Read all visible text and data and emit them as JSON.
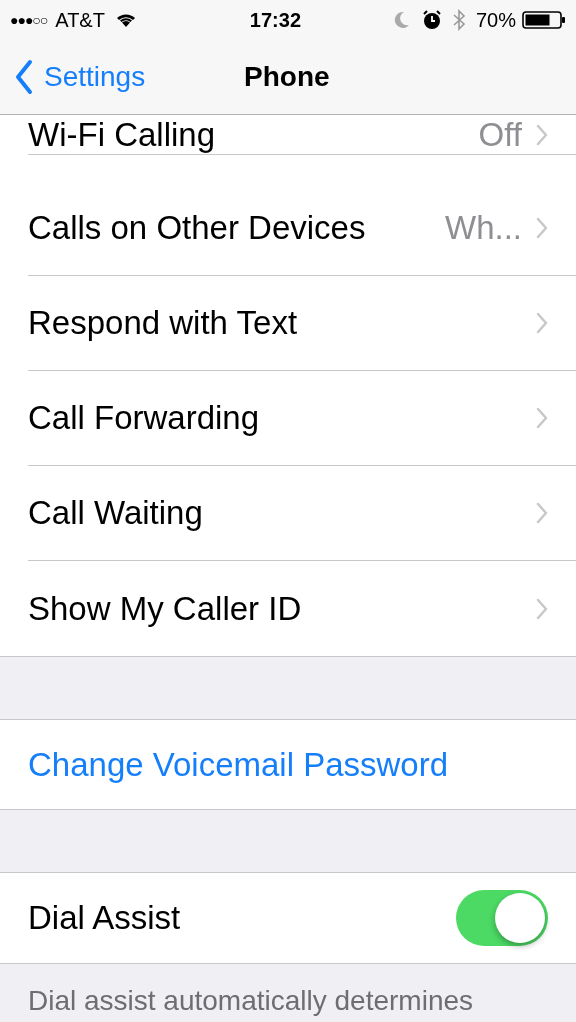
{
  "status_bar": {
    "signal": "●●●○○",
    "carrier": "AT&T",
    "time": "17:32",
    "battery": "70%"
  },
  "nav": {
    "back": "Settings",
    "title": "Phone"
  },
  "rows": [
    {
      "label": "Wi-Fi Calling",
      "value": "Off"
    },
    {
      "label": "Calls on Other Devices",
      "value": "Wh..."
    },
    {
      "label": "Respond with Text"
    },
    {
      "label": "Call Forwarding"
    },
    {
      "label": "Call Waiting"
    },
    {
      "label": "Show My Caller ID"
    }
  ],
  "voicemail": {
    "label": "Change Voicemail Password"
  },
  "dial_assist": {
    "label": "Dial Assist",
    "on": true,
    "footer": "Dial assist automatically determines"
  }
}
